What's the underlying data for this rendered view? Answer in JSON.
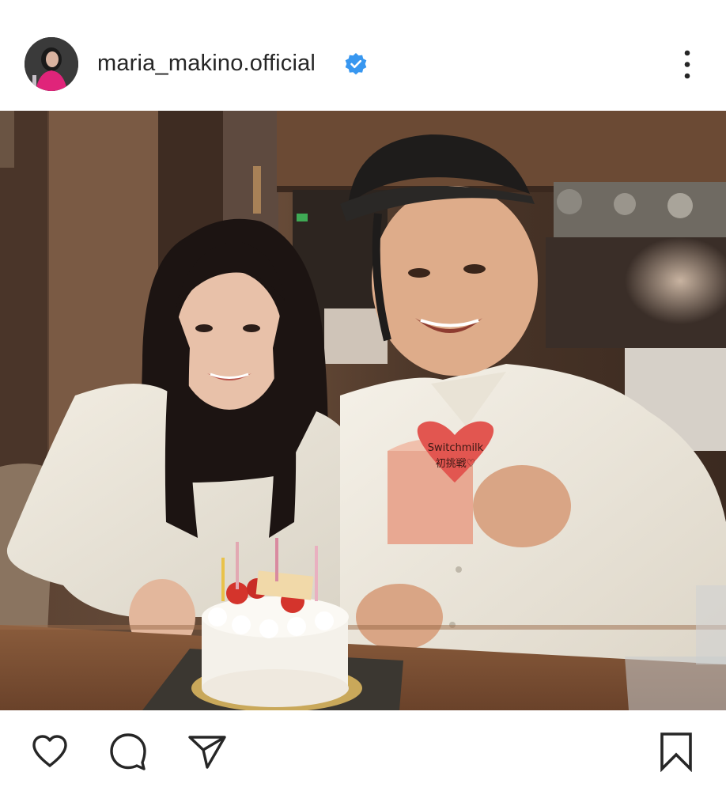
{
  "post": {
    "username": "maria_makino.official",
    "verified": true
  },
  "photo": {
    "card_text_line1": "Switchmilk",
    "card_text_line2": "初挑戦♡"
  },
  "icons": {
    "verified": "verified-badge-icon",
    "more": "more-options-icon",
    "like": "heart-icon",
    "comment": "comment-icon",
    "share": "send-icon",
    "save": "bookmark-icon"
  },
  "colors": {
    "verified_blue": "#3897f0",
    "text": "#262626"
  }
}
